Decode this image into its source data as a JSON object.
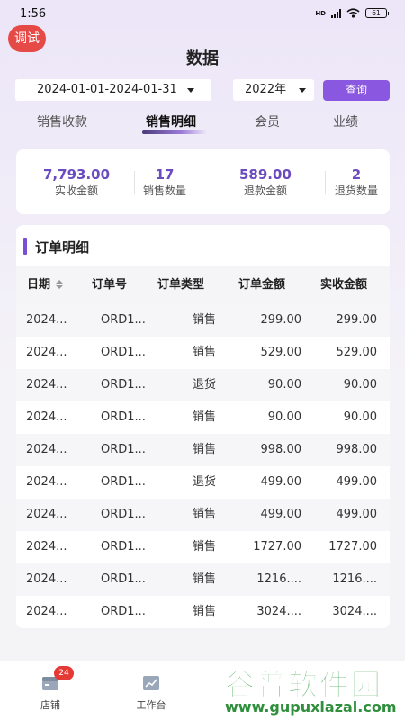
{
  "status_bar": {
    "time": "1:56",
    "network": "HD",
    "battery": "61"
  },
  "debug_badge": "调试",
  "page_title": "数据",
  "filters": {
    "date_range": "2024-01-01-2024-01-31",
    "year": "2022年",
    "query_label": "查询"
  },
  "tabs": [
    {
      "label": "销售收款",
      "active": false
    },
    {
      "label": "销售明细",
      "active": true
    },
    {
      "label": "会员",
      "active": false
    },
    {
      "label": "业绩",
      "active": false
    }
  ],
  "summary": [
    {
      "value": "7,793.00",
      "label": "实收金额"
    },
    {
      "value": "17",
      "label": "销售数量"
    },
    {
      "value": "589.00",
      "label": "退款金额"
    },
    {
      "value": "2",
      "label": "退货数量"
    }
  ],
  "orders": {
    "title": "订单明细",
    "columns": [
      "日期",
      "订单号",
      "订单类型",
      "订单金额",
      "实收金额"
    ],
    "rows": [
      [
        "2024...",
        "ORD1...",
        "销售",
        "299.00",
        "299.00"
      ],
      [
        "2024...",
        "ORD1...",
        "销售",
        "529.00",
        "529.00"
      ],
      [
        "2024...",
        "ORD1...",
        "退货",
        "90.00",
        "90.00"
      ],
      [
        "2024...",
        "ORD1...",
        "销售",
        "90.00",
        "90.00"
      ],
      [
        "2024...",
        "ORD1...",
        "销售",
        "998.00",
        "998.00"
      ],
      [
        "2024...",
        "ORD1...",
        "退货",
        "499.00",
        "499.00"
      ],
      [
        "2024...",
        "ORD1...",
        "销售",
        "499.00",
        "499.00"
      ],
      [
        "2024...",
        "ORD1...",
        "销售",
        "1727.00",
        "1727.00"
      ],
      [
        "2024...",
        "ORD1...",
        "销售",
        "1216....",
        "1216...."
      ],
      [
        "2024...",
        "ORD1...",
        "销售",
        "3024....",
        "3024...."
      ]
    ]
  },
  "bottom_nav": [
    {
      "label": "店铺",
      "icon": "store-icon",
      "badge": "24"
    },
    {
      "label": "工作台",
      "icon": "chart-icon"
    }
  ],
  "watermark": {
    "text": "谷普软件园",
    "url": "www.gupuxlazal.com"
  },
  "colors": {
    "accent": "#8a57e0",
    "stat_value": "#6a4bc0",
    "debug": "#e64a46",
    "badge": "#e53935",
    "watermark": "#3aa24a"
  }
}
